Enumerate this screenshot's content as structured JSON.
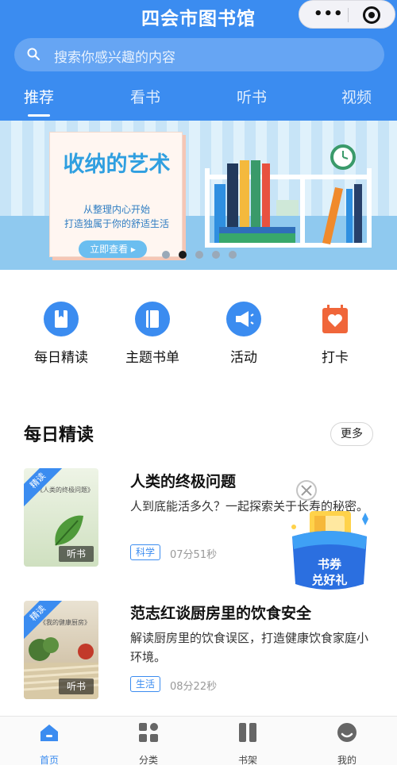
{
  "header": {
    "title": "四会市图书馆",
    "search_placeholder": "搜索你感兴趣的内容",
    "tabs": [
      {
        "label": "推荐",
        "active": true
      },
      {
        "label": "看书",
        "active": false
      },
      {
        "label": "听书",
        "active": false
      },
      {
        "label": "视频",
        "active": false
      }
    ]
  },
  "banner": {
    "title": "收纳的艺术",
    "subtitle_1": "从整理内心开始",
    "subtitle_2": "打造独属于你的舒适生活",
    "button_label": "立即查看 ▸",
    "slide_count": 5,
    "active_slide": 1
  },
  "quick_entries": [
    {
      "label": "每日精读",
      "icon": "bookmark-book-icon"
    },
    {
      "label": "主题书单",
      "icon": "booklist-icon"
    },
    {
      "label": "活动",
      "icon": "megaphone-icon"
    },
    {
      "label": "打卡",
      "icon": "calendar-heart-icon"
    }
  ],
  "daily_reading": {
    "section_title": "每日精读",
    "more_label": "更多",
    "items": [
      {
        "ribbon": "精读",
        "cover_text": "《人类的终极问题》",
        "cover_author": "",
        "cover_tag": "听书",
        "title": "人类的终极问题",
        "description": "人到底能活多久？一起探索关于长寿的秘密。",
        "category": "科学",
        "duration": "07分51秒"
      },
      {
        "ribbon": "精读",
        "cover_text": "《我的健康厨房》",
        "cover_author": "",
        "cover_tag": "听书",
        "title": "范志红谈厨房里的饮食安全",
        "description": "解读厨房里的饮食误区，打造健康饮食家庭小环境。",
        "category": "生活",
        "duration": "08分22秒"
      }
    ]
  },
  "floating_ad": {
    "text_line_1": "书券",
    "text_line_2": "兑好礼",
    "close_icon": "close-icon"
  },
  "bottom_nav": [
    {
      "label": "首页",
      "icon": "home-icon",
      "active": true
    },
    {
      "label": "分类",
      "icon": "grid-icon",
      "active": false
    },
    {
      "label": "书架",
      "icon": "bookshelf-icon",
      "active": false
    },
    {
      "label": "我的",
      "icon": "profile-icon",
      "active": false
    }
  ],
  "colors": {
    "primary": "#3b8cf0",
    "banner_bg": "#d5ecf9",
    "coupon_blue": "#2b6fe0",
    "coupon_yellow": "#ffd24a"
  }
}
